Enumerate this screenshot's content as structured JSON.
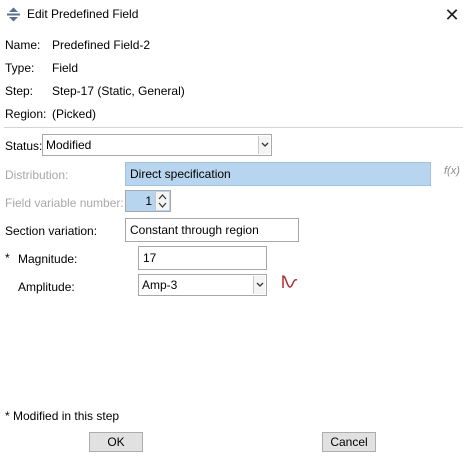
{
  "window": {
    "title": "Edit Predefined Field",
    "close_glyph": "✕"
  },
  "info": {
    "name_label": "Name:",
    "name_value": "Predefined Field-2",
    "type_label": "Type:",
    "type_value": "Field",
    "step_label": "Step:",
    "step_value": "Step-17 (Static, General)",
    "region_label": "Region:",
    "region_value": "(Picked)"
  },
  "status": {
    "label": "Status:",
    "value": "Modified"
  },
  "distribution": {
    "label": "Distribution:",
    "value": "Direct specification",
    "fx_glyph": "f(x)"
  },
  "field_variable": {
    "label": "Field variable number:",
    "value": "1"
  },
  "section_variation": {
    "label": "Section variation:",
    "value": "Constant through region"
  },
  "magnitude": {
    "marker": "*",
    "label": "Magnitude:",
    "value": "17"
  },
  "amplitude": {
    "label": "Amplitude:",
    "value": "Amp-3",
    "icon_color": "#b03030"
  },
  "footer": {
    "note": "* Modified in this step",
    "ok_label": "OK",
    "cancel_label": "Cancel"
  }
}
